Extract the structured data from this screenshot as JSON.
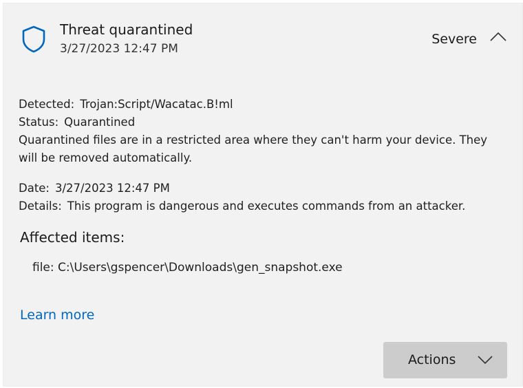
{
  "header": {
    "title": "Threat quarantined",
    "timestamp": "3/27/2023 12:47 PM",
    "severity": "Severe",
    "shield_icon": "shield-icon",
    "collapse_icon": "chevron-up-icon",
    "accent_color": "#0067c0"
  },
  "details": {
    "detected_label": "Detected:",
    "detected_value": "Trojan:Script/Wacatac.B!ml",
    "status_label": "Status:",
    "status_value": "Quarantined",
    "status_description": "Quarantined files are in a restricted area where they can't harm your device. They will be removed automatically.",
    "date_label": "Date:",
    "date_value": "3/27/2023 12:47 PM",
    "details_label": "Details:",
    "details_value": "This program is dangerous and executes commands from an attacker."
  },
  "affected": {
    "title": "Affected items:",
    "items": [
      {
        "text": "file: C:\\Users\\gspencer\\Downloads\\gen_snapshot.exe"
      }
    ]
  },
  "learn_more": "Learn more",
  "actions": {
    "label": "Actions",
    "icon": "chevron-down-icon"
  }
}
